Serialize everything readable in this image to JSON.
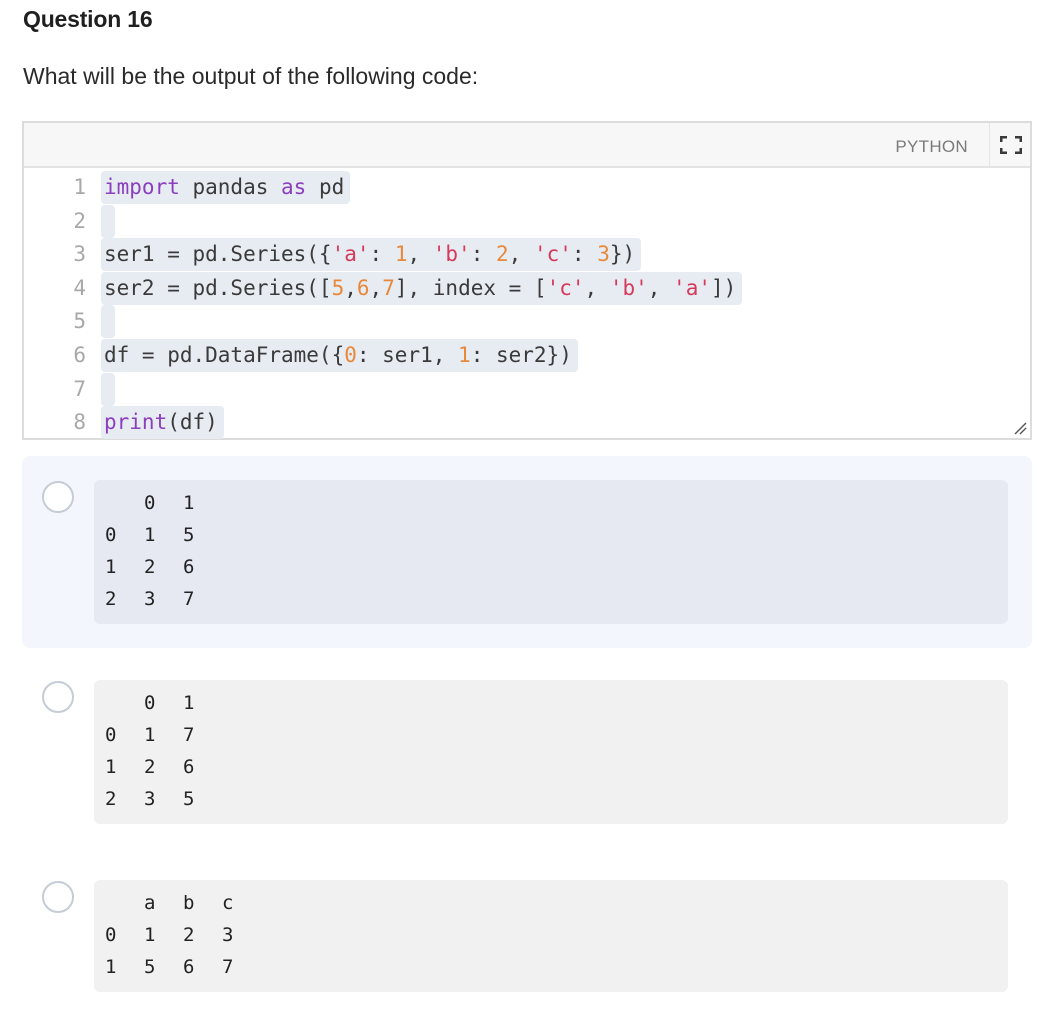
{
  "question": {
    "title": "Question 16",
    "prompt": "What will be the output of the following code:"
  },
  "code_widget": {
    "language": "PYTHON",
    "fullscreen_icon": "expand-icon",
    "resize_icon": "resize-handle-icon",
    "lines": [
      {
        "no": "1",
        "tokens": [
          {
            "t": "import",
            "c": "kw"
          },
          {
            "t": " pandas ",
            "c": ""
          },
          {
            "t": "as",
            "c": "kw"
          },
          {
            "t": " pd",
            "c": ""
          }
        ]
      },
      {
        "no": "2",
        "tokens": []
      },
      {
        "no": "3",
        "tokens": [
          {
            "t": "ser1 = pd.Series({",
            "c": ""
          },
          {
            "t": "'a'",
            "c": "str"
          },
          {
            "t": ": ",
            "c": ""
          },
          {
            "t": "1",
            "c": "num"
          },
          {
            "t": ", ",
            "c": ""
          },
          {
            "t": "'b'",
            "c": "str"
          },
          {
            "t": ": ",
            "c": ""
          },
          {
            "t": "2",
            "c": "num"
          },
          {
            "t": ", ",
            "c": ""
          },
          {
            "t": "'c'",
            "c": "str"
          },
          {
            "t": ": ",
            "c": ""
          },
          {
            "t": "3",
            "c": "num"
          },
          {
            "t": "})",
            "c": ""
          }
        ]
      },
      {
        "no": "4",
        "tokens": [
          {
            "t": "ser2 = pd.Series([",
            "c": ""
          },
          {
            "t": "5",
            "c": "num"
          },
          {
            "t": ",",
            "c": ""
          },
          {
            "t": "6",
            "c": "num"
          },
          {
            "t": ",",
            "c": ""
          },
          {
            "t": "7",
            "c": "num"
          },
          {
            "t": "], index = [",
            "c": ""
          },
          {
            "t": "'c'",
            "c": "str"
          },
          {
            "t": ", ",
            "c": ""
          },
          {
            "t": "'b'",
            "c": "str"
          },
          {
            "t": ", ",
            "c": ""
          },
          {
            "t": "'a'",
            "c": "str"
          },
          {
            "t": "])",
            "c": ""
          }
        ]
      },
      {
        "no": "5",
        "tokens": []
      },
      {
        "no": "6",
        "tokens": [
          {
            "t": "df = pd.DataFrame({",
            "c": ""
          },
          {
            "t": "0",
            "c": "num"
          },
          {
            "t": ": ser1, ",
            "c": ""
          },
          {
            "t": "1",
            "c": "num"
          },
          {
            "t": ": ser2})",
            "c": ""
          }
        ]
      },
      {
        "no": "7",
        "tokens": []
      },
      {
        "no": "8",
        "tokens": [
          {
            "t": "print",
            "c": "kw"
          },
          {
            "t": "(df)",
            "c": ""
          }
        ]
      }
    ]
  },
  "options": [
    {
      "selected": false,
      "highlighted": true,
      "rows": [
        [
          "",
          "0",
          "1"
        ],
        [
          "0",
          "1",
          "5"
        ],
        [
          "1",
          "2",
          "6"
        ],
        [
          "2",
          "3",
          "7"
        ]
      ]
    },
    {
      "selected": false,
      "highlighted": false,
      "rows": [
        [
          "",
          "0",
          "1"
        ],
        [
          "0",
          "1",
          "7"
        ],
        [
          "1",
          "2",
          "6"
        ],
        [
          "2",
          "3",
          "5"
        ]
      ]
    },
    {
      "selected": false,
      "highlighted": false,
      "rows": [
        [
          "",
          "a",
          "b",
          "c"
        ],
        [
          "0",
          "1",
          "2",
          "3"
        ],
        [
          "1",
          "5",
          "6",
          "7"
        ]
      ]
    }
  ]
}
